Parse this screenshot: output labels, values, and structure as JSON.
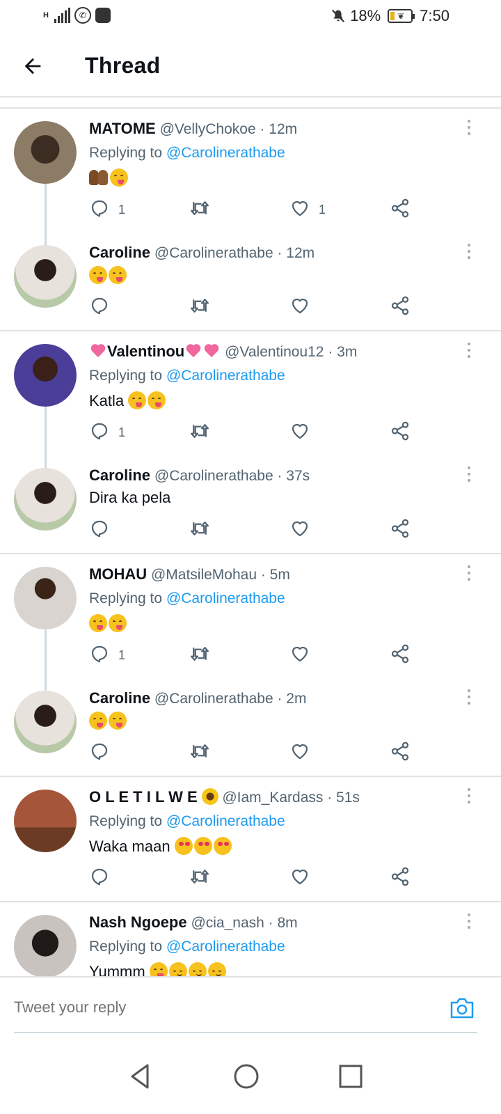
{
  "status_bar": {
    "network": "H",
    "battery": "18%",
    "time": "7:50",
    "battery_level": 0.18
  },
  "header": {
    "title": "Thread"
  },
  "replying_prefix": "Replying to",
  "groups": [
    {
      "tweets": [
        {
          "name": "MATOME",
          "handle": "@VellyChokoe",
          "time": "· 12m",
          "replying_to": "@Carolinerathabe",
          "text": "",
          "emojis": [
            "hands",
            "yum"
          ],
          "reply_count": "1",
          "like_count": "1"
        },
        {
          "name": "Caroline",
          "handle": "@Carolinerathabe",
          "time": "· 12m",
          "text": "",
          "emojis": [
            "yum",
            "yum"
          ],
          "reply_count": "",
          "like_count": ""
        }
      ]
    },
    {
      "tweets": [
        {
          "name": "Valentinou",
          "handle": "@Valentinou12",
          "time": "· 3m",
          "replying_to": "@Carolinerathabe",
          "text": "Katla",
          "emojis": [
            "yum",
            "yum"
          ],
          "reply_count": "1",
          "like_count": ""
        },
        {
          "name": "Caroline",
          "handle": "@Carolinerathabe",
          "time": "· 37s",
          "text": "Dira ka pela",
          "emojis": [],
          "reply_count": "",
          "like_count": ""
        }
      ]
    },
    {
      "tweets": [
        {
          "name": "MOHAU",
          "handle": "@MatsileMohau",
          "time": "· 5m",
          "replying_to": "@Carolinerathabe",
          "text": "",
          "emojis": [
            "yum",
            "yum"
          ],
          "reply_count": "1",
          "like_count": ""
        },
        {
          "name": "Caroline",
          "handle": "@Carolinerathabe",
          "time": "· 2m",
          "text": "",
          "emojis": [
            "yum",
            "yum"
          ],
          "reply_count": "",
          "like_count": ""
        }
      ]
    },
    {
      "tweets": [
        {
          "name": "O L E T I L W E",
          "handle": "@Iam_Kardass",
          "time": "· 51s",
          "replying_to": "@Carolinerathabe",
          "text": "Waka maan",
          "emojis": [
            "love",
            "love",
            "love"
          ],
          "reply_count": "",
          "like_count": ""
        }
      ]
    },
    {
      "tweets": [
        {
          "name": "Nash Ngoepe",
          "handle": "@cia_nash",
          "time": "· 8m",
          "replying_to": "@Carolinerathabe",
          "text": "Yummm",
          "emojis": [
            "yum",
            "relief",
            "relief",
            "relief"
          ],
          "reply_count": "",
          "like_count": ""
        }
      ]
    }
  ],
  "reply_bar": {
    "placeholder": "Tweet your reply"
  },
  "colors": {
    "link": "#1d9bf0",
    "secondary_text": "#536471",
    "divider": "#dfe3e6"
  }
}
